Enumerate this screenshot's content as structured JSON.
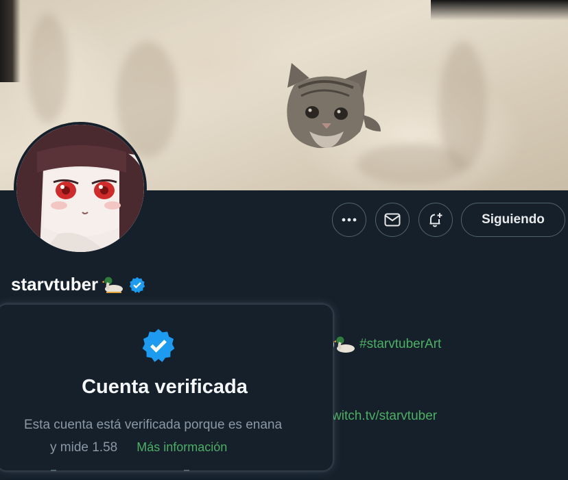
{
  "profile": {
    "display_name": "starvtuber",
    "name_emoji": "duck-emoji",
    "verified_icon": "verified-badge-icon"
  },
  "actions": {
    "more_icon": "more-icon",
    "message_icon": "mail-icon",
    "notify_icon": "bell-plus-icon",
    "follow_label": "Siguiendo"
  },
  "bio": {
    "hashtag": "#starvtuberArt",
    "link_partial": "witch.tv/starvtuber"
  },
  "verified_popup": {
    "title": "Cuenta verificada",
    "text_line1": "Esta cuenta está verificada porque es enana",
    "text_line2": "y mide 1.58",
    "more_link": "Más información"
  },
  "colors": {
    "background": "#15202b",
    "border": "#536471",
    "verified_blue": "#1d9bf0",
    "link_green": "#4caf64"
  }
}
